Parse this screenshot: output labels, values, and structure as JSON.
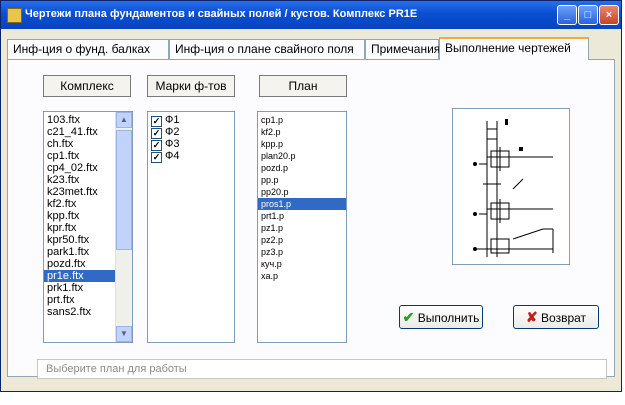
{
  "window": {
    "title": "Чертежи плана фундаментов и свайных полей / кустов. Комплекс PR1E",
    "minimize_label": "_",
    "maximize_label": "□",
    "close_label": "×"
  },
  "tabs": [
    {
      "label": "Инф-ция о фунд. балках",
      "active": false
    },
    {
      "label": "Инф-ция о плане свайного поля",
      "active": false
    },
    {
      "label": "Примечания",
      "active": false
    },
    {
      "label": "Выполнение чертежей",
      "active": true
    }
  ],
  "columns": {
    "complex_label": "Комплекс",
    "marks_label": "Марки ф-тов",
    "plan_label": "План"
  },
  "complex_list": {
    "items": [
      "103.ftx",
      "c21_41.ftx",
      "ch.ftx",
      "cp1.ftx",
      "cp4_02.ftx",
      "k23.ftx",
      "k23met.ftx",
      "kf2.ftx",
      "kpp.ftx",
      "kpr.ftx",
      "kpr50.ftx",
      "park1.ftx",
      "pozd.ftx",
      "pr1e.ftx",
      "prk1.ftx",
      "prt.ftx",
      "sans2.ftx"
    ],
    "selected": "pr1e.ftx"
  },
  "marks_list": {
    "items": [
      {
        "label": "Ф1",
        "checked": true
      },
      {
        "label": "Ф2",
        "checked": true
      },
      {
        "label": "Ф3",
        "checked": true
      },
      {
        "label": "Ф4",
        "checked": true
      }
    ]
  },
  "plan_list": {
    "items": [
      "cp1.p",
      "kf2.p",
      "kpp.p",
      "plan20.p",
      "pozd.p",
      "pp.p",
      "pp20.p",
      "pros1.p",
      "prt1.p",
      "pz1.p",
      "pz2.p",
      "pz3.p",
      "куч.p",
      "xa.p"
    ],
    "selected": "pros1.p"
  },
  "buttons": {
    "execute_label": "Выполнить",
    "return_label": "Возврат"
  },
  "status": {
    "placeholder": "Выберите план для работы"
  },
  "icons": {
    "check_color": "#21a121",
    "cross_color": "#c0201a",
    "title_bar_color": "#0a4fd1",
    "selection_color": "#316ac5"
  }
}
